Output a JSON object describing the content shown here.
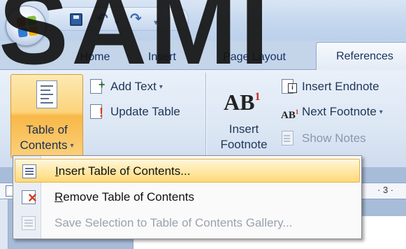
{
  "watermark": "SAMI",
  "tabs": {
    "home": "Home",
    "insert": "Insert",
    "page_layout": "Page Layout",
    "references": "References"
  },
  "ribbon": {
    "toc": {
      "line1": "Table of",
      "line2": "Contents",
      "caret": "▾"
    },
    "add_text": "Add Text",
    "update_table": "Update Table",
    "insert_footnote": {
      "icon_text": "AB",
      "icon_sup": "1",
      "line1": "Insert",
      "line2": "Footnote"
    },
    "insert_endnote": "Insert Endnote",
    "next_footnote": "Next Footnote",
    "show_notes": "Show Notes"
  },
  "menu": {
    "items": [
      {
        "label_underlined": "I",
        "label_rest": "nsert Table of Contents..."
      },
      {
        "label_underlined": "R",
        "label_rest": "emove Table of Contents"
      },
      {
        "label_underlined": "",
        "label_rest": "Save Selection to Table of Contents Gallery..."
      }
    ]
  },
  "ruler": {
    "mark": "· 3 ·"
  },
  "colors": {
    "highlight": "#ffe8a6",
    "accent_orange": "#f8b848",
    "ribbon_blue": "#dce7f4"
  }
}
